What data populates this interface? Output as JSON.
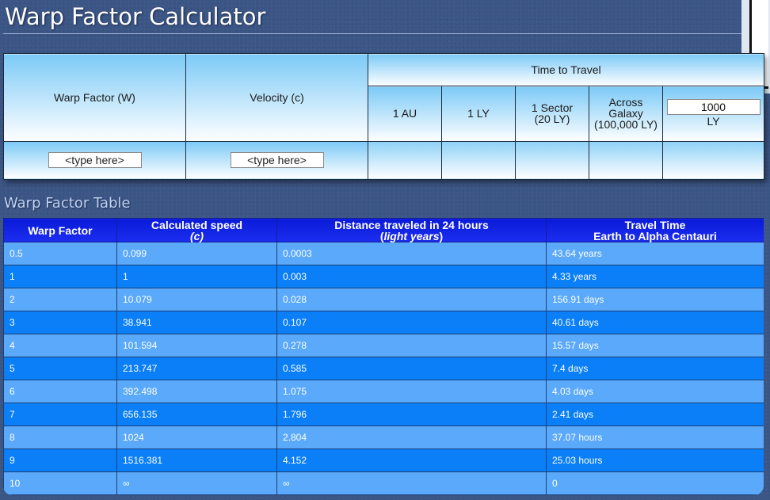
{
  "page": {
    "title": "Warp Factor Calculator",
    "background": "#3b5585"
  },
  "calculator": {
    "headers": {
      "warp_factor": "Warp Factor (W)",
      "velocity": "Velocity (c)",
      "time_to_travel": "Time to Travel",
      "au": "1 AU",
      "ly": "1 LY",
      "sector_line1": "1 Sector",
      "sector_line2": "(20 LY)",
      "galaxy_line1": "Across",
      "galaxy_line2": "Galaxy",
      "galaxy_line3": "(100,000 LY)",
      "custom_ly_unit": "LY"
    },
    "custom_ly_value": "1000",
    "warp_input_value": "<type here>",
    "velocity_input_value": "<type here>"
  },
  "warp_table": {
    "title": "Warp Factor Table",
    "header_color": "#0a1ad8",
    "row_colors": {
      "odd": "#5aa9fb",
      "even": "#0a7ff7"
    },
    "columns": {
      "warp": "Warp Factor",
      "speed_line1": "Calculated speed",
      "speed_line2": "(c)",
      "distance_line1": "Distance traveled in 24 hours",
      "distance_unit": "light years",
      "travel_line1": "Travel Time",
      "travel_line2": "Earth to Alpha Centauri"
    },
    "rows": [
      {
        "warp": "0.5",
        "speed": "0.099",
        "distance": "0.0003",
        "travel": "43.64 years"
      },
      {
        "warp": "1",
        "speed": "1",
        "distance": "0.003",
        "travel": "4.33 years"
      },
      {
        "warp": "2",
        "speed": "10.079",
        "distance": "0.028",
        "travel": "156.91 days"
      },
      {
        "warp": "3",
        "speed": "38.941",
        "distance": "0.107",
        "travel": "40.61 days"
      },
      {
        "warp": "4",
        "speed": "101.594",
        "distance": "0.278",
        "travel": "15.57 days"
      },
      {
        "warp": "5",
        "speed": "213.747",
        "distance": "0.585",
        "travel": "7.4 days"
      },
      {
        "warp": "6",
        "speed": "392.498",
        "distance": "1.075",
        "travel": "4.03 days"
      },
      {
        "warp": "7",
        "speed": "656.135",
        "distance": "1.796",
        "travel": "2.41 days"
      },
      {
        "warp": "8",
        "speed": "1024",
        "distance": "2.804",
        "travel": "37.07 hours"
      },
      {
        "warp": "9",
        "speed": "1516.381",
        "distance": "4.152",
        "travel": "25.03 hours"
      },
      {
        "warp": "10",
        "speed": "∞",
        "distance": "∞",
        "travel": "0"
      }
    ]
  }
}
